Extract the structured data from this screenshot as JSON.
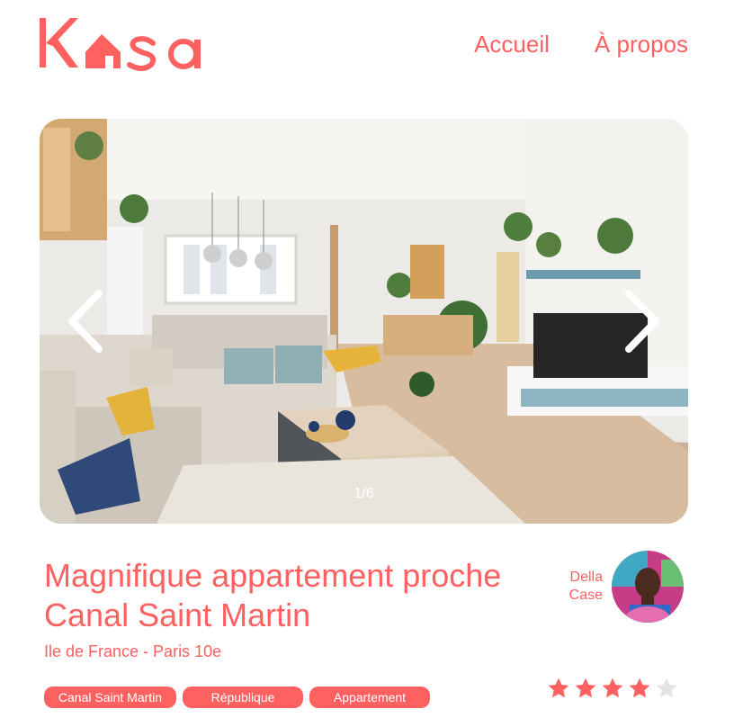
{
  "brand": {
    "name": "Kasa",
    "color": "#ff6060"
  },
  "nav": {
    "home": "Accueil",
    "about": "À propos"
  },
  "gallery": {
    "counter": "1/6",
    "prev_icon": "chevron-left-icon",
    "next_icon": "chevron-right-icon"
  },
  "listing": {
    "title": "Magnifique appartement proche Canal Saint Martin",
    "location": "Ile de France - Paris 10e",
    "tags": [
      "Canal Saint Martin",
      "République",
      "Appartement"
    ],
    "rating": 4,
    "rating_max": 5
  },
  "host": {
    "first_name": "Della",
    "last_name": "Case"
  },
  "colors": {
    "accent": "#ff6060",
    "star_empty": "#e3e3e3"
  }
}
